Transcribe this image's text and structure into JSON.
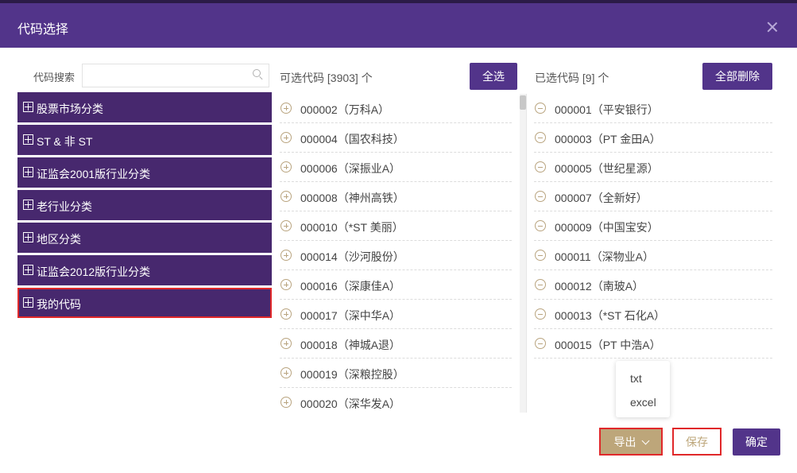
{
  "dialog": {
    "title": "代码选择"
  },
  "search": {
    "label": "代码搜索",
    "value": "",
    "placeholder": ""
  },
  "categories": [
    {
      "label": "股票市场分类"
    },
    {
      "label": "ST & 非 ST"
    },
    {
      "label": "证监会2001版行业分类"
    },
    {
      "label": "老行业分类"
    },
    {
      "label": "地区分类"
    },
    {
      "label": "证监会2012版行业分类"
    },
    {
      "label": "我的代码"
    }
  ],
  "available": {
    "title": "可选代码 [3903] 个",
    "select_all_label": "全选",
    "items": [
      {
        "text": "000002（万科A）"
      },
      {
        "text": "000004（国农科技）"
      },
      {
        "text": "000006（深振业A）"
      },
      {
        "text": "000008（神州高铁）"
      },
      {
        "text": "000010（*ST 美丽）"
      },
      {
        "text": "000014（沙河股份）"
      },
      {
        "text": "000016（深康佳A）"
      },
      {
        "text": "000017（深中华A）"
      },
      {
        "text": "000018（神城A退）"
      },
      {
        "text": "000019（深粮控股）"
      },
      {
        "text": "000020（深华发A）"
      }
    ]
  },
  "selected": {
    "title": "已选代码 [9] 个",
    "delete_all_label": "全部删除",
    "items": [
      {
        "text": "000001（平安银行）"
      },
      {
        "text": "000003（PT 金田A）"
      },
      {
        "text": "000005（世纪星源）"
      },
      {
        "text": "000007（全新好）"
      },
      {
        "text": "000009（中国宝安）"
      },
      {
        "text": "000011（深物业A）"
      },
      {
        "text": "000012（南玻A）"
      },
      {
        "text": "000013（*ST 石化A）"
      },
      {
        "text": "000015（PT 中浩A）"
      }
    ]
  },
  "export_menu": {
    "options": [
      {
        "label": "txt"
      },
      {
        "label": "excel"
      }
    ]
  },
  "footer": {
    "export_label": "导出",
    "save_label": "保存",
    "ok_label": "确定"
  },
  "colors": {
    "header_purple": "#52348a",
    "category_purple": "#47286e",
    "gold": "#bda67a",
    "highlight_red": "#e0282a"
  }
}
